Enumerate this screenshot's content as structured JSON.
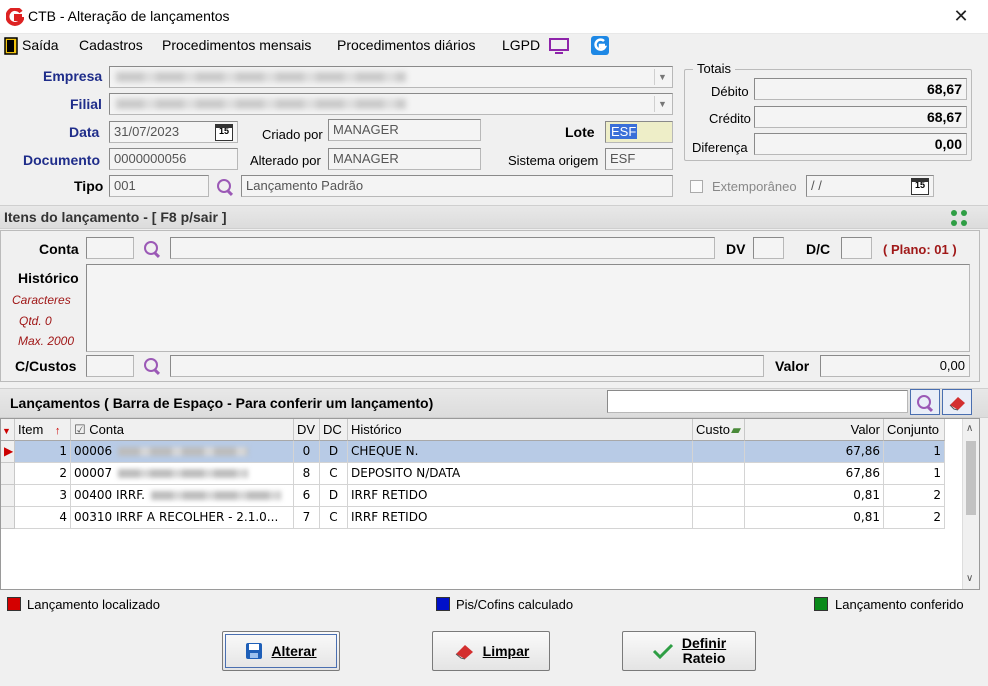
{
  "window": {
    "title": "CTB - Alteração de lançamentos",
    "close": "✕"
  },
  "menu": [
    "Saída",
    "Cadastros",
    "Procedimentos mensais",
    "Procedimentos diários",
    "LGPD"
  ],
  "header": {
    "empresa_label": "Empresa",
    "filial_label": "Filial",
    "data_label": "Data",
    "data_value": "31/07/2023",
    "calendar_glyph": "15",
    "criado_por_label": "Criado por",
    "criado_por_value": "MANAGER",
    "lote_label": "Lote",
    "lote_value": "ESF",
    "documento_label": "Documento",
    "documento_value": "0000000056",
    "alterado_por_label": "Alterado por",
    "alterado_por_value": "MANAGER",
    "sistema_origem_label": "Sistema origem",
    "sistema_origem_value": "ESF",
    "tipo_label": "Tipo",
    "tipo_code": "001",
    "tipo_desc": "Lançamento Padrão",
    "extemporaneo_label": "Extemporâneo",
    "extemporaneo_value": " / /"
  },
  "totais": {
    "title": "Totais",
    "debito_label": "Débito",
    "debito_value": "68,67",
    "credito_label": "Crédito",
    "credito_value": "68,67",
    "diferenca_label": "Diferença",
    "diferenca_value": "0,00"
  },
  "itens": {
    "section_title": "Itens do lançamento - [ F8 p/sair ]",
    "conta_label": "Conta",
    "dv_label": "DV",
    "dc_label": "D/C",
    "plano_text": "( Plano: 01 )",
    "historico_label": "Histórico",
    "caracteres_label": "Caracteres",
    "qtd_label": "Qtd. 0",
    "max_label": "Max. 2000",
    "ccustos_label": "C/Custos",
    "valor_label": "Valor",
    "valor_value": "0,00"
  },
  "lancamentos": {
    "section_title": "Lançamentos ( Barra de Espaço - Para conferir um lançamento)",
    "columns": [
      "Item",
      "Conta",
      "DV",
      "DC",
      "Histórico",
      "Custo",
      "Valor",
      "Conjunto"
    ],
    "rows": [
      {
        "item": "1",
        "conta": "00006",
        "dv": "0",
        "dc": "D",
        "historico": "CHEQUE N.",
        "custo": "",
        "valor": "67,86",
        "conjunto": "1",
        "selected": true,
        "blurred": true
      },
      {
        "item": "2",
        "conta": "00007",
        "dv": "8",
        "dc": "C",
        "historico": "DEPOSITO N/DATA",
        "custo": "",
        "valor": "67,86",
        "conjunto": "1",
        "selected": false,
        "blurred": true
      },
      {
        "item": "3",
        "conta": "00400 IRRF.",
        "dv": "6",
        "dc": "D",
        "historico": "IRRF RETIDO",
        "custo": "",
        "valor": "0,81",
        "conjunto": "2",
        "selected": false,
        "blurred": true
      },
      {
        "item": "4",
        "conta": "00310 IRRF A RECOLHER - 2.1.0...",
        "dv": "7",
        "dc": "C",
        "historico": "IRRF RETIDO",
        "custo": "",
        "valor": "0,81",
        "conjunto": "2",
        "selected": false,
        "blurred": false
      }
    ]
  },
  "legend": {
    "localizado": "Lançamento localizado",
    "pis_cofins": "Pis/Cofins calculado",
    "conferido": "Lançamento conferido",
    "colors": {
      "localizado": "#d40000",
      "pis_cofins": "#0010c8",
      "conferido": "#0a8a1a"
    }
  },
  "buttons": {
    "alterar": "Alterar",
    "limpar": "Limpar",
    "definir_rateio_1": "Definir",
    "definir_rateio_2": "Rateio"
  },
  "colors": {
    "selection": "#b8cbe6",
    "lote_bg": "#eeeec8",
    "label_blue": "#1f2d8a",
    "plano_red": "#a01818"
  }
}
